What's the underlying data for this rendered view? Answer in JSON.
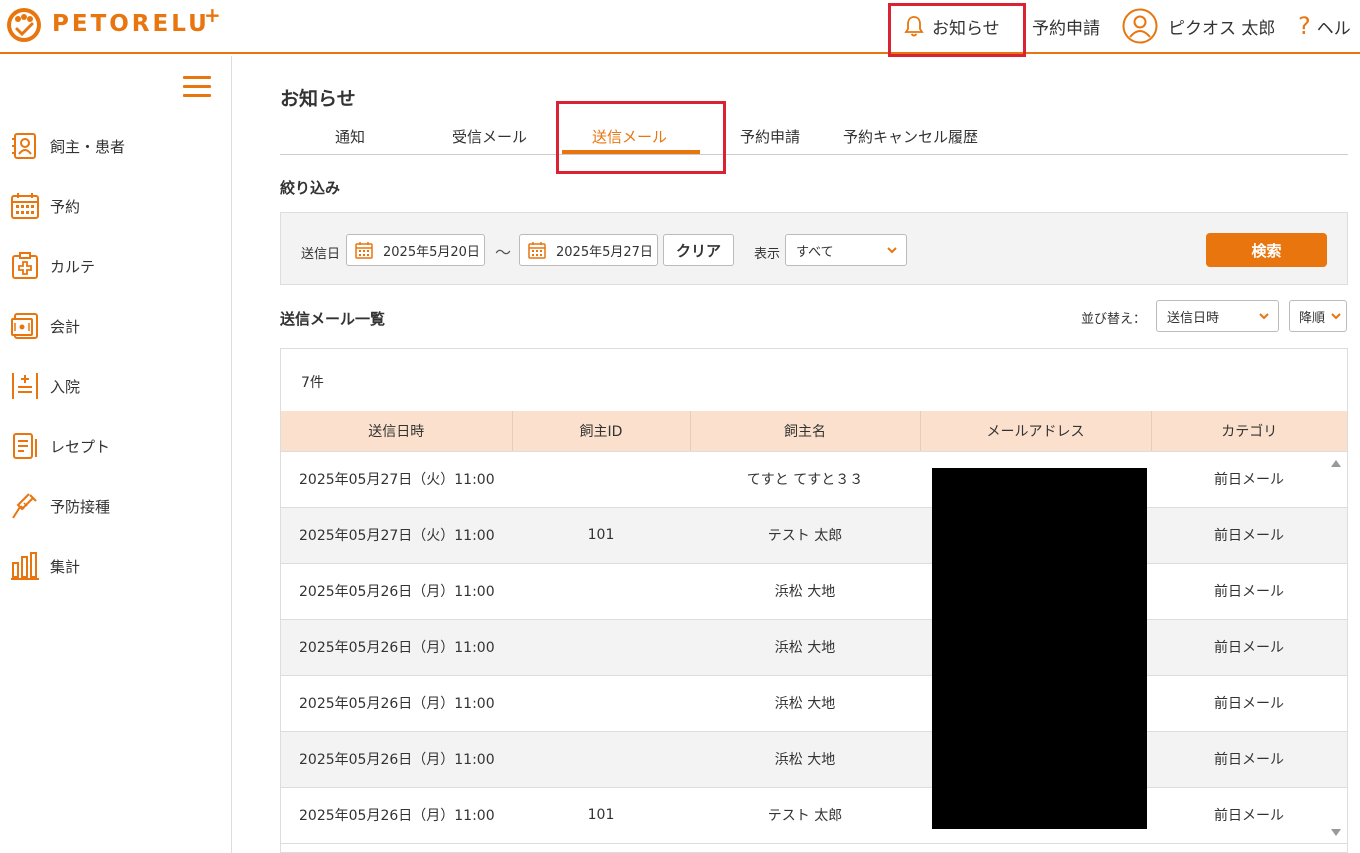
{
  "brand": {
    "name": "PETORELU",
    "plus": "+"
  },
  "header": {
    "notice": "お知らせ",
    "reserve": "予約申請",
    "user": "ピクオス 太郎",
    "help": "ヘル"
  },
  "sidebar": {
    "items": [
      {
        "label": "飼主・患者",
        "icon": "owner-patient-icon"
      },
      {
        "label": "予約",
        "icon": "calendar-icon"
      },
      {
        "label": "カルテ",
        "icon": "chart-record-icon"
      },
      {
        "label": "会計",
        "icon": "register-icon"
      },
      {
        "label": "入院",
        "icon": "hospitalization-icon"
      },
      {
        "label": "レセプト",
        "icon": "receipt-icon"
      },
      {
        "label": "予防接種",
        "icon": "syringe-icon"
      },
      {
        "label": "集計",
        "icon": "bar-chart-icon"
      }
    ]
  },
  "page": {
    "title": "お知らせ",
    "tabs": [
      {
        "label": "通知",
        "active": false
      },
      {
        "label": "受信メール",
        "active": false
      },
      {
        "label": "送信メール",
        "active": true
      },
      {
        "label": "予約申請",
        "active": false
      },
      {
        "label": "予約キャンセル履歴",
        "active": false
      }
    ]
  },
  "filter": {
    "heading": "絞り込み",
    "date_label": "送信日",
    "date_from": "2025年5月20日",
    "date_sep": "～",
    "date_to": "2025年5月27日",
    "clear_label": "クリア",
    "display_label": "表示",
    "display_value": "すべて",
    "search_label": "検索"
  },
  "list": {
    "heading": "送信メール一覧",
    "sort_label": "並び替え：",
    "sort_field": "送信日時",
    "sort_order": "降順",
    "count": "7件",
    "columns": [
      "送信日時",
      "飼主ID",
      "飼主名",
      "メールアドレス",
      "カテゴリ"
    ],
    "rows": [
      {
        "datetime": "2025年05月27日（火）11:00",
        "owner_id": "",
        "owner_name": "てすと てすと３３",
        "email": "",
        "category": "前日メール"
      },
      {
        "datetime": "2025年05月27日（火）11:00",
        "owner_id": "101",
        "owner_name": "テスト 太郎",
        "email": "",
        "category": "前日メール"
      },
      {
        "datetime": "2025年05月26日（月）11:00",
        "owner_id": "",
        "owner_name": "浜松 大地",
        "email": "",
        "category": "前日メール"
      },
      {
        "datetime": "2025年05月26日（月）11:00",
        "owner_id": "",
        "owner_name": "浜松 大地",
        "email": "",
        "category": "前日メール"
      },
      {
        "datetime": "2025年05月26日（月）11:00",
        "owner_id": "",
        "owner_name": "浜松 大地",
        "email": "",
        "category": "前日メール"
      },
      {
        "datetime": "2025年05月26日（月）11:00",
        "owner_id": "",
        "owner_name": "浜松 大地",
        "email": "",
        "category": "前日メール"
      },
      {
        "datetime": "2025年05月26日（月）11:00",
        "owner_id": "101",
        "owner_name": "テスト 太郎",
        "email": "",
        "category": "前日メール"
      }
    ]
  },
  "colors": {
    "accent": "#e8750e",
    "highlight": "#d92332",
    "header_row": "#fbe1cd"
  }
}
